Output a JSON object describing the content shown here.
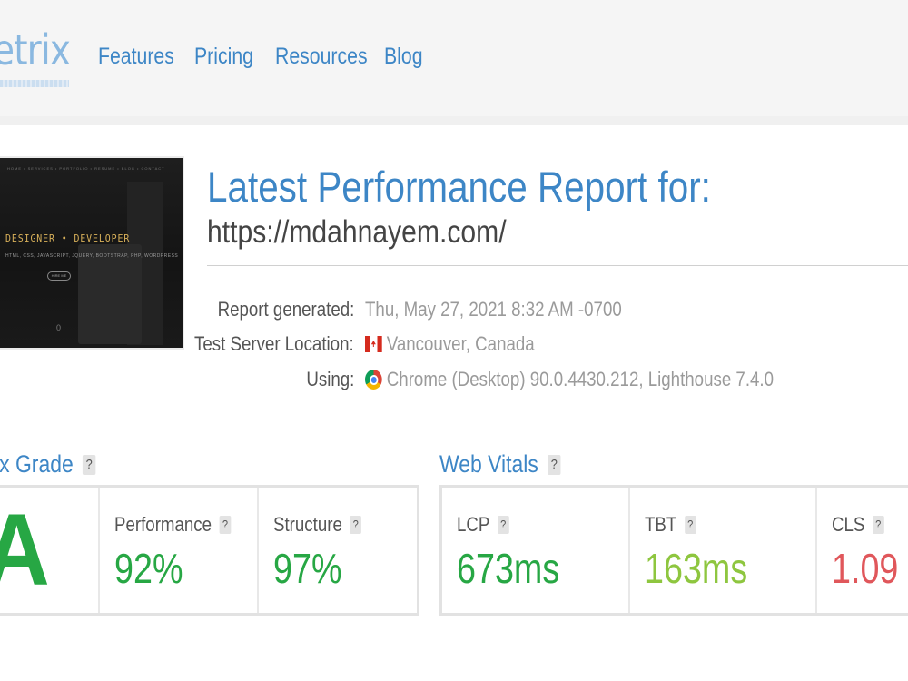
{
  "header": {
    "logo_text": "etrix",
    "nav": [
      "Features",
      "Pricing",
      "Resources",
      "Blog"
    ]
  },
  "thumbnail": {
    "nav_text": "HOME  •  SERVICES  •  PORTFOLIO  •  RESUME  •  BLOG  •  CONTACT",
    "title": "DESIGNER • DEVELOPER",
    "subtitle": "HTML, CSS, JAVASCRIPT, JQUERY, BOOTSTRAP, PHP, WORDPRESS",
    "button": "HIRE ME",
    "icon": "0"
  },
  "report": {
    "title": "Latest Performance Report for:",
    "url": "https://mdahnayem.com/",
    "rows": [
      {
        "label": "Report generated:",
        "value": "Thu, May 27, 2021 8:32 AM -0700",
        "icon": ""
      },
      {
        "label": "Test Server Location:",
        "value": "Vancouver, Canada",
        "icon": "canada-flag-icon"
      },
      {
        "label": "Using:",
        "value": "Chrome (Desktop) 90.0.4430.212, Lighthouse 7.4.0",
        "icon": "chrome-icon"
      }
    ]
  },
  "grade": {
    "title": "ix Grade",
    "help": "?",
    "letter": "A",
    "letter_color": "#27a744",
    "metrics": [
      {
        "label": "Performance",
        "value": "92%",
        "color": "#27a744"
      },
      {
        "label": "Structure",
        "value": "97%",
        "color": "#27a744"
      }
    ]
  },
  "vitals": {
    "title": "Web Vitals",
    "help": "?",
    "metrics": [
      {
        "label": "LCP",
        "value": "673ms",
        "color": "#27a744"
      },
      {
        "label": "TBT",
        "value": "163ms",
        "color": "#8ec63f"
      },
      {
        "label": "CLS",
        "value": "1.09",
        "color": "#e0575b"
      }
    ]
  },
  "colors": {
    "brand_blue": "#3d86c6",
    "good_green": "#27a744",
    "ok_green": "#8ec63f",
    "bad_red": "#e0575b"
  }
}
